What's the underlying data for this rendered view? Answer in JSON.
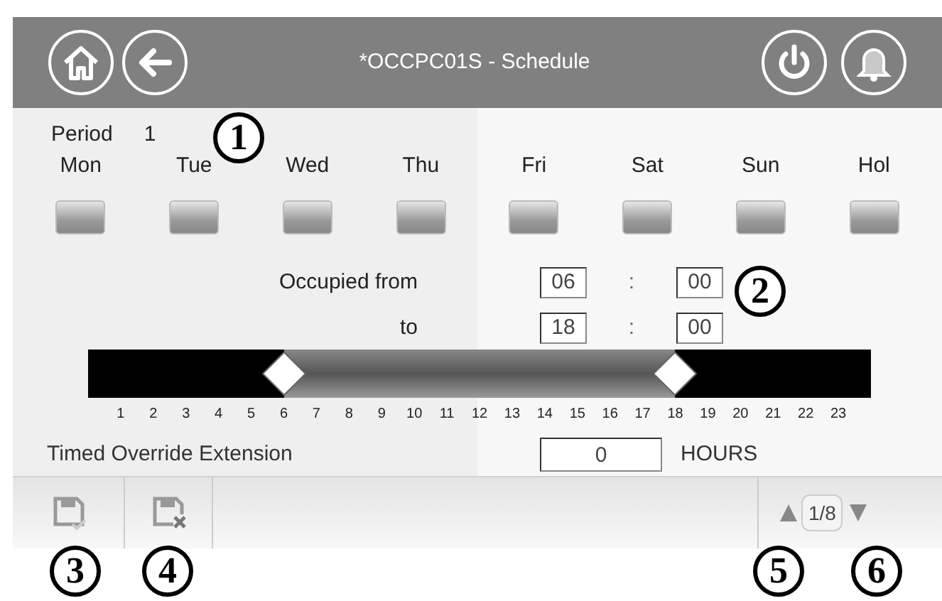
{
  "header": {
    "title": "*OCCPC01S - Schedule"
  },
  "period": {
    "label": "Period",
    "value": "1"
  },
  "days": [
    {
      "label": "Mon"
    },
    {
      "label": "Tue"
    },
    {
      "label": "Wed"
    },
    {
      "label": "Thu"
    },
    {
      "label": "Fri"
    },
    {
      "label": "Sat"
    },
    {
      "label": "Sun"
    },
    {
      "label": "Hol"
    }
  ],
  "occupied": [
    {
      "label": "Occupied from",
      "hours": "06",
      "separator": ":",
      "minutes": "00"
    },
    {
      "label": "to",
      "hours": "18",
      "separator": ":",
      "minutes": "00"
    }
  ],
  "timeline": {
    "thumbs": [
      {
        "level": 0.25
      },
      {
        "level": 0.75
      }
    ],
    "ticks": [
      "1",
      "2",
      "3",
      "4",
      "5",
      "6",
      "7",
      "8",
      "9",
      "10",
      "11",
      "12",
      "13",
      "14",
      "15",
      "16",
      "17",
      "18",
      "19",
      "20",
      "21",
      "22",
      "23"
    ]
  },
  "override": {
    "label": "Timed Override Extension",
    "value": "0",
    "unit": "HOURS"
  },
  "footer": {
    "page": "1/8"
  },
  "callouts": [
    "1",
    "2",
    "3",
    "4",
    "5",
    "6"
  ]
}
